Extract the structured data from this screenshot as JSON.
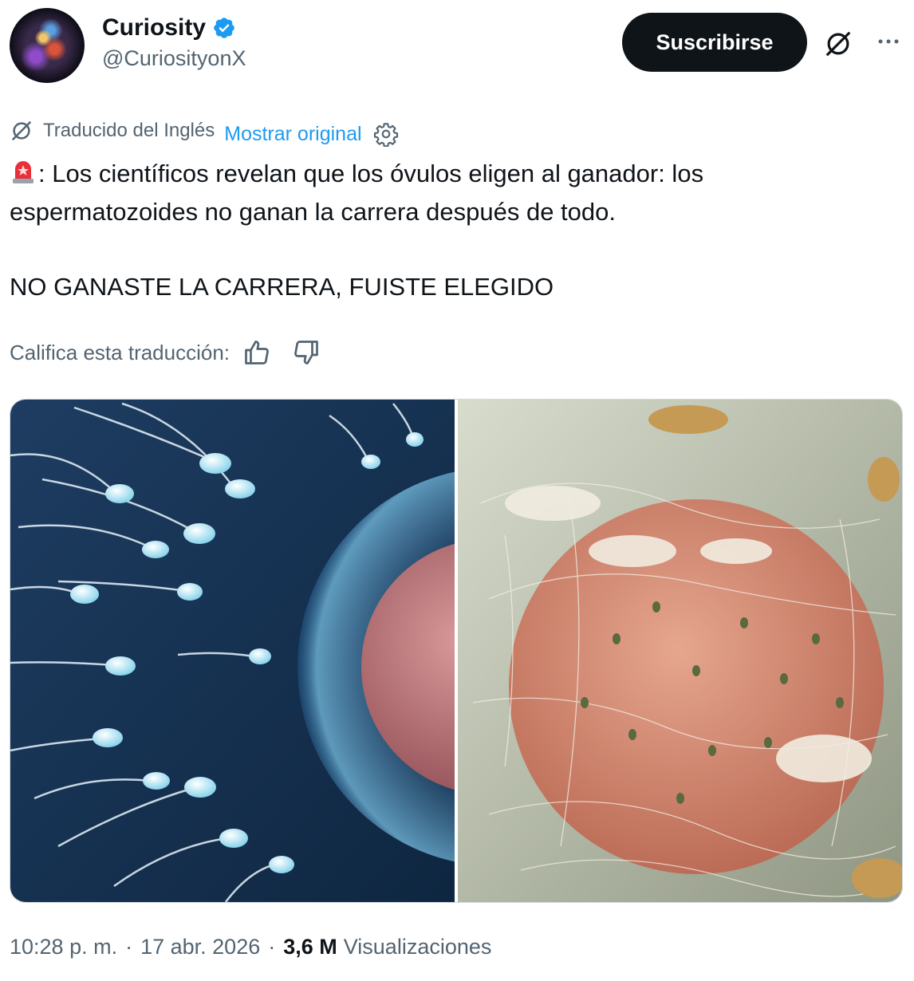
{
  "author": {
    "name": "Curiosity",
    "handle": "@CuriosityonX",
    "verified": true,
    "badge_color": "#1d9bf0"
  },
  "actions": {
    "subscribe_label": "Suscribirse",
    "grok_icon": "grok-icon",
    "more_icon": "more-icon"
  },
  "translation": {
    "label": "Traducido del Inglés",
    "show_original": "Mostrar original",
    "settings_icon": "gear-icon"
  },
  "tweet": {
    "emoji": "🚨",
    "line1": ": Los científicos revelan que los óvulos eligen al ganador: los espermatozoides no ganan la carrera después de todo.",
    "line2": "NO GANASTE LA CARRERA, FUISTE ELEGIDO"
  },
  "rating": {
    "label": "Califica esta traducción:",
    "like_icon": "thumbs-up-icon",
    "dislike_icon": "thumbs-down-icon"
  },
  "footer": {
    "time": "10:28 p. m.",
    "separator": "·",
    "date": "17 abr. 2026",
    "separator2": "·",
    "views_count": "3,6 M",
    "views_label": "Visualizaciones"
  },
  "colors": {
    "text": "#0f1419",
    "muted": "#536471",
    "link": "#1d9bf0",
    "button_bg": "#0f1419"
  }
}
